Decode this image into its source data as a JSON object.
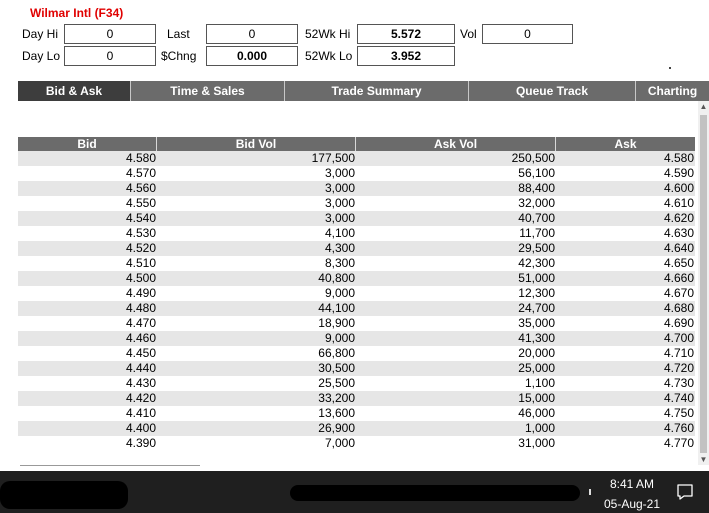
{
  "title": "Wilmar Intl (F34)",
  "quote": {
    "day_hi_label": "Day Hi",
    "day_hi": "0",
    "last_label": "Last",
    "last": "0",
    "wk52_hi_label": "52Wk Hi",
    "wk52_hi": "5.572",
    "vol_label": "Vol",
    "vol": "0",
    "day_lo_label": "Day Lo",
    "day_lo": "0",
    "chng_label": "$Chng",
    "chng": "0.000",
    "wk52_lo_label": "52Wk Lo",
    "wk52_lo": "3.952"
  },
  "tabs": [
    {
      "label": "Bid & Ask",
      "active": true
    },
    {
      "label": "Time & Sales",
      "active": false
    },
    {
      "label": "Trade Summary",
      "active": false
    },
    {
      "label": "Queue Track",
      "active": false
    },
    {
      "label": "Charting",
      "active": false
    }
  ],
  "table": {
    "headers": [
      "Bid",
      "Bid Vol",
      "Ask Vol",
      "Ask"
    ],
    "rows": [
      [
        "4.580",
        "177,500",
        "250,500",
        "4.580"
      ],
      [
        "4.570",
        "3,000",
        "56,100",
        "4.590"
      ],
      [
        "4.560",
        "3,000",
        "88,400",
        "4.600"
      ],
      [
        "4.550",
        "3,000",
        "32,000",
        "4.610"
      ],
      [
        "4.540",
        "3,000",
        "40,700",
        "4.620"
      ],
      [
        "4.530",
        "4,100",
        "11,700",
        "4.630"
      ],
      [
        "4.520",
        "4,300",
        "29,500",
        "4.640"
      ],
      [
        "4.510",
        "8,300",
        "42,300",
        "4.650"
      ],
      [
        "4.500",
        "40,800",
        "51,000",
        "4.660"
      ],
      [
        "4.490",
        "9,000",
        "12,300",
        "4.670"
      ],
      [
        "4.480",
        "44,100",
        "24,700",
        "4.680"
      ],
      [
        "4.470",
        "18,900",
        "35,000",
        "4.690"
      ],
      [
        "4.460",
        "9,000",
        "41,300",
        "4.700"
      ],
      [
        "4.450",
        "66,800",
        "20,000",
        "4.710"
      ],
      [
        "4.440",
        "30,500",
        "25,000",
        "4.720"
      ],
      [
        "4.430",
        "25,500",
        "1,100",
        "4.730"
      ],
      [
        "4.420",
        "33,200",
        "15,000",
        "4.740"
      ],
      [
        "4.410",
        "13,600",
        "46,000",
        "4.750"
      ],
      [
        "4.400",
        "26,900",
        "1,000",
        "4.760"
      ],
      [
        "4.390",
        "7,000",
        "31,000",
        "4.770"
      ]
    ]
  },
  "taskbar": {
    "time": "8:41 AM",
    "date": "05-Aug-21",
    "notification_icon": "speech-bubble-icon"
  },
  "colors": {
    "title": "#e00000",
    "tab_bg": "#6b6b6b",
    "tab_active_bg": "#3d3d3d",
    "row_stripe": "#e6e6e6",
    "taskbar": "#1f1f1f"
  }
}
